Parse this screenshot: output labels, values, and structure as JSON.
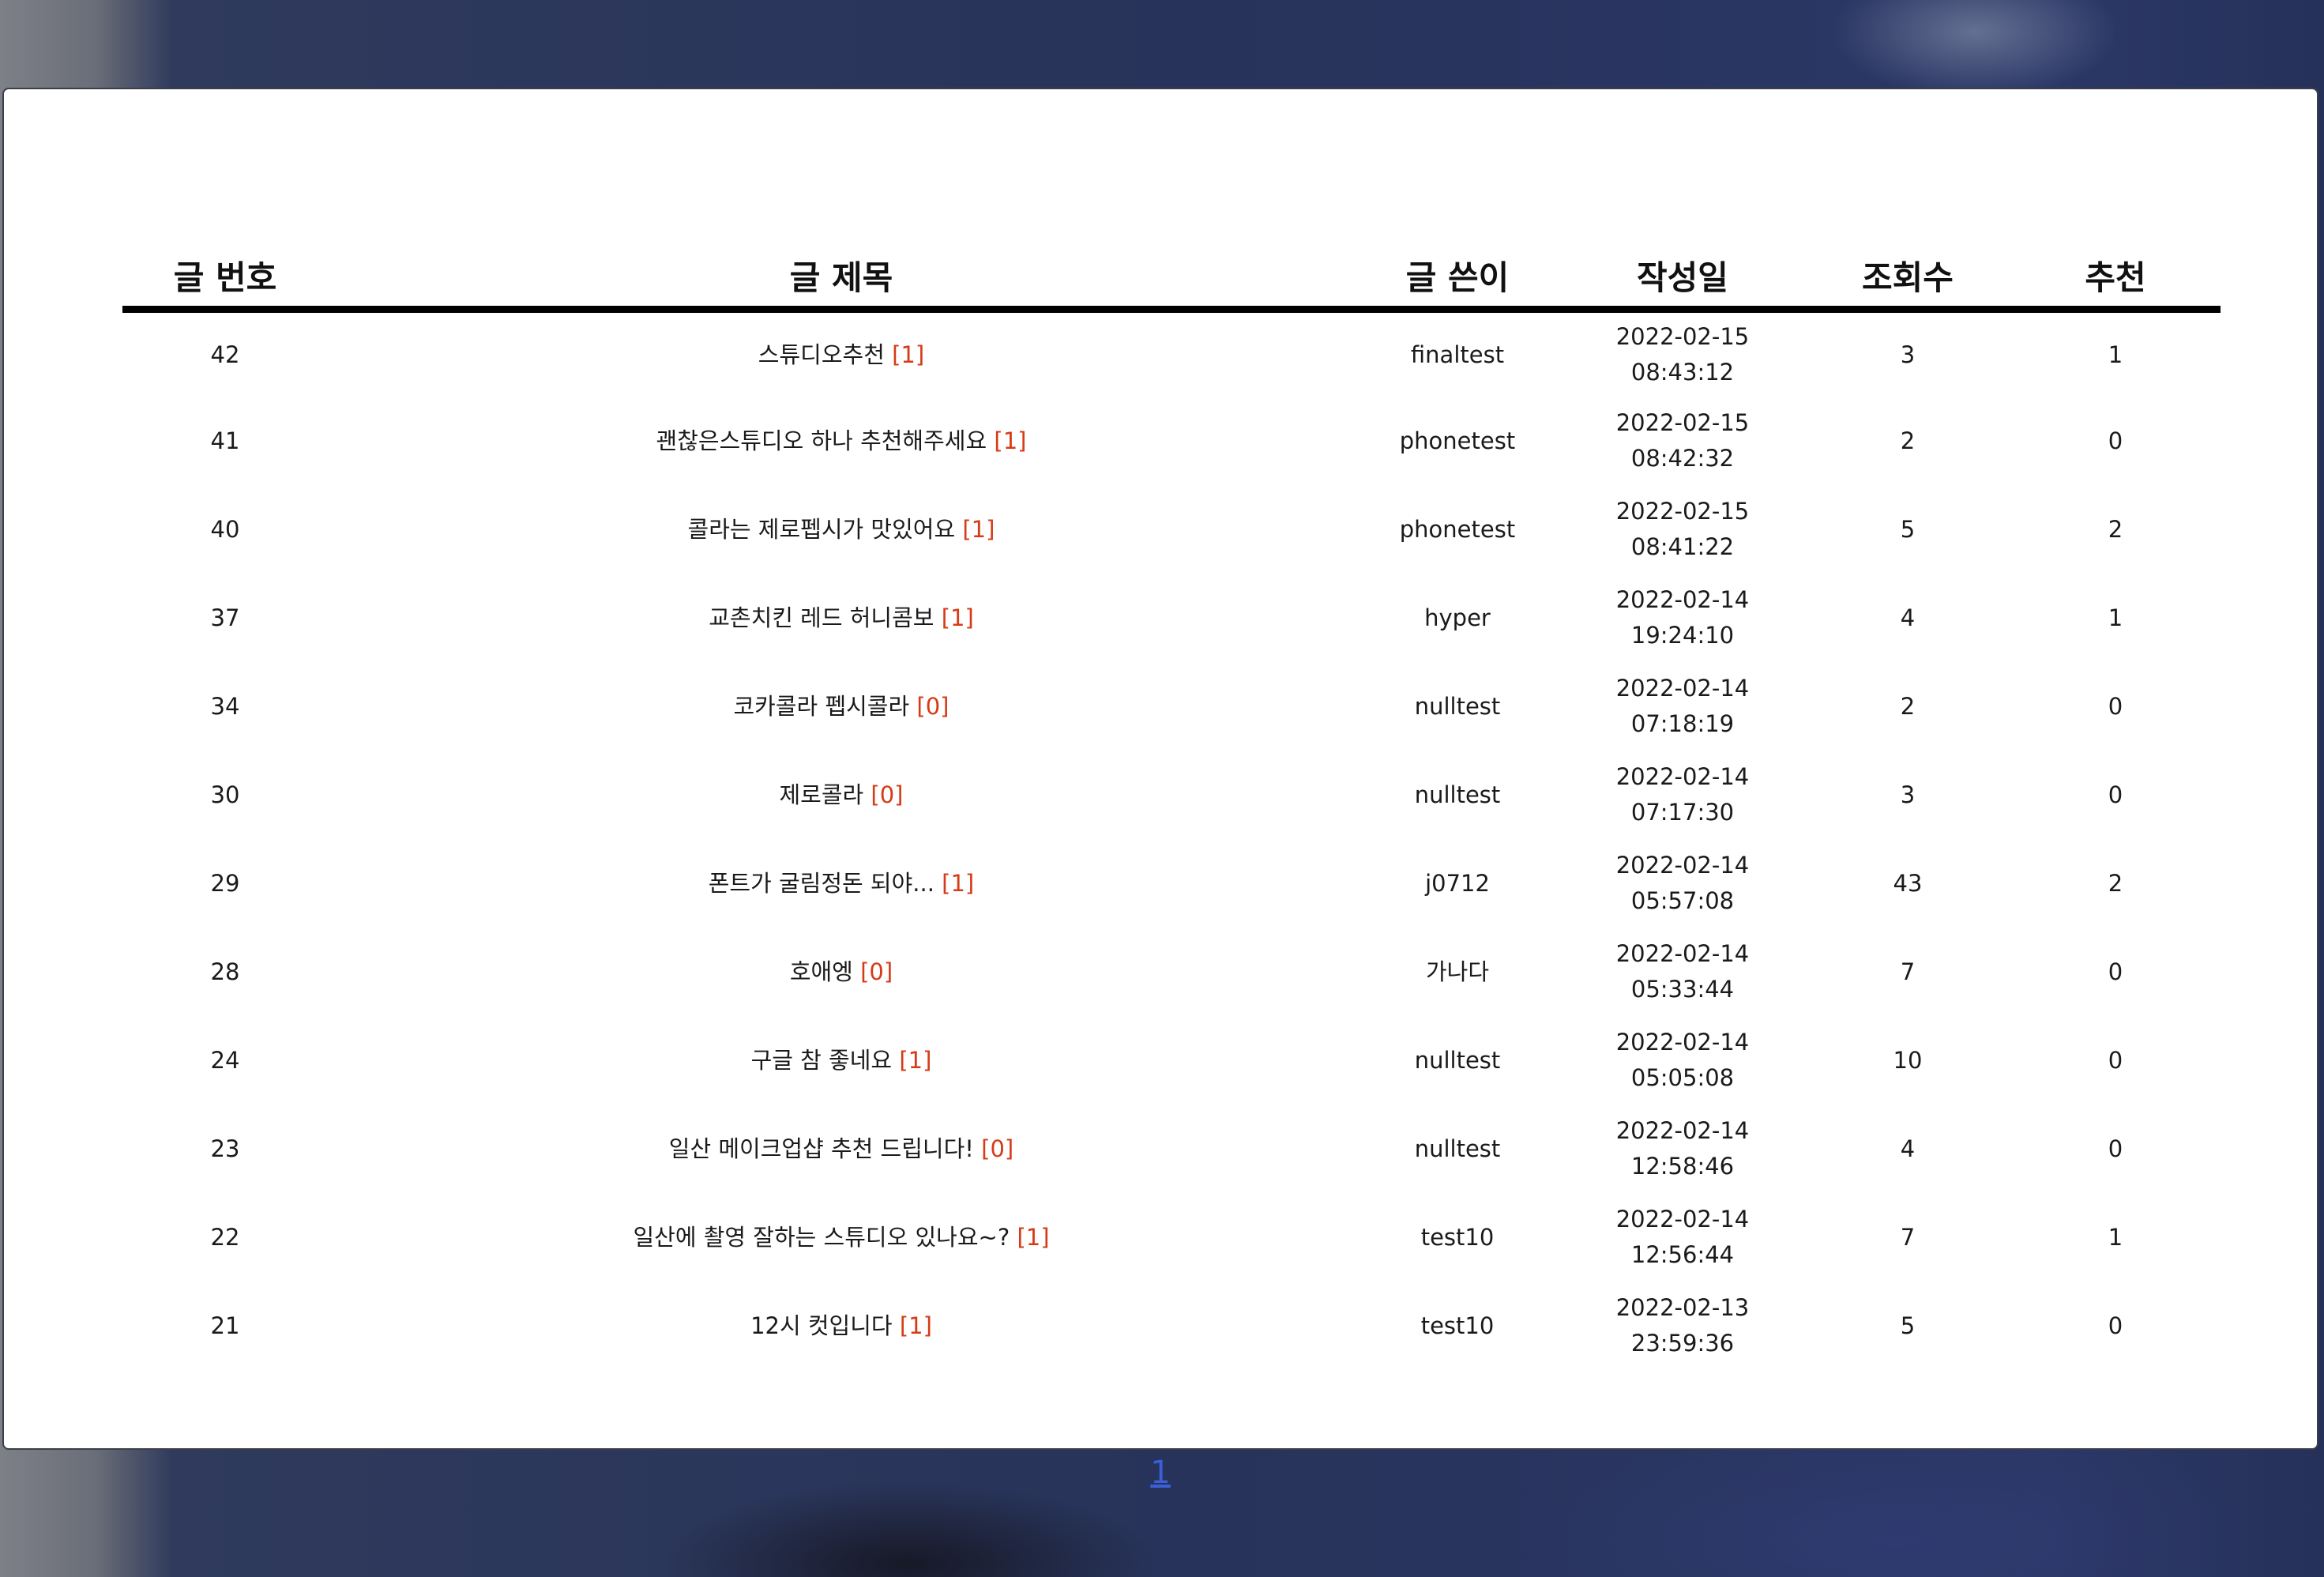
{
  "board": {
    "columns": [
      "글 번호",
      "글 제목",
      "글 쓴이",
      "작성일",
      "조회수",
      "추천"
    ],
    "posts": [
      {
        "num": "42",
        "title": "스튜디오추천",
        "comments": "[1]",
        "author": "finaltest",
        "date": "2022-02-15",
        "time": "08:43:12",
        "views": "3",
        "likes": "1"
      },
      {
        "num": "41",
        "title": "괜찮은스튜디오 하나 추천해주세요",
        "comments": "[1]",
        "author": "phonetest",
        "date": "2022-02-15",
        "time": "08:42:32",
        "views": "2",
        "likes": "0"
      },
      {
        "num": "40",
        "title": "콜라는 제로펩시가 맛있어요",
        "comments": "[1]",
        "author": "phonetest",
        "date": "2022-02-15",
        "time": "08:41:22",
        "views": "5",
        "likes": "2"
      },
      {
        "num": "37",
        "title": "교촌치킨 레드 허니콤보",
        "comments": "[1]",
        "author": "hyper",
        "date": "2022-02-14",
        "time": "19:24:10",
        "views": "4",
        "likes": "1"
      },
      {
        "num": "34",
        "title": "코카콜라 펩시콜라",
        "comments": "[0]",
        "author": "nulltest",
        "date": "2022-02-14",
        "time": "07:18:19",
        "views": "2",
        "likes": "0"
      },
      {
        "num": "30",
        "title": "제로콜라",
        "comments": "[0]",
        "author": "nulltest",
        "date": "2022-02-14",
        "time": "07:17:30",
        "views": "3",
        "likes": "0"
      },
      {
        "num": "29",
        "title": "폰트가 굴림정돈 되야...",
        "comments": "[1]",
        "author": "j0712",
        "date": "2022-02-14",
        "time": "05:57:08",
        "views": "43",
        "likes": "2"
      },
      {
        "num": "28",
        "title": "호애엥",
        "comments": "[0]",
        "author": "가나다",
        "date": "2022-02-14",
        "time": "05:33:44",
        "views": "7",
        "likes": "0"
      },
      {
        "num": "24",
        "title": "구글 참 좋네요",
        "comments": "[1]",
        "author": "nulltest",
        "date": "2022-02-14",
        "time": "05:05:08",
        "views": "10",
        "likes": "0"
      },
      {
        "num": "23",
        "title": "일산 메이크업샵 추천 드립니다!",
        "comments": "[0]",
        "author": "nulltest",
        "date": "2022-02-14",
        "time": "12:58:46",
        "views": "4",
        "likes": "0"
      },
      {
        "num": "22",
        "title": "일산에 촬영 잘하는 스튜디오 있나요~?",
        "comments": "[1]",
        "author": "test10",
        "date": "2022-02-14",
        "time": "12:56:44",
        "views": "7",
        "likes": "1"
      },
      {
        "num": "21",
        "title": "12시 컷입니다",
        "comments": "[1]",
        "author": "test10",
        "date": "2022-02-13",
        "time": "23:59:36",
        "views": "5",
        "likes": "0"
      }
    ]
  },
  "pagination": {
    "pages": [
      "1"
    ]
  },
  "colors": {
    "comment_count": "#d63b17",
    "page_link": "#3a5fd6",
    "header_rule": "#000000"
  }
}
